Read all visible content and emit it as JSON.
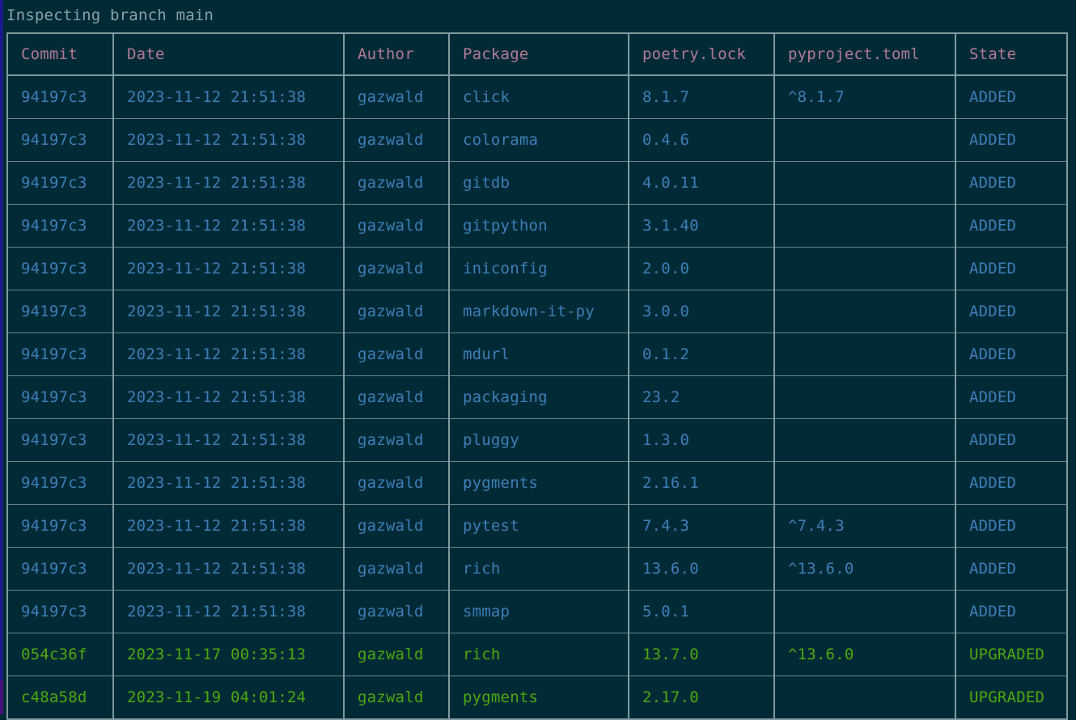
{
  "terminal": {
    "status_line": "Inspecting branch main",
    "colors": {
      "background": "#002b36",
      "border": "#7d9aa0",
      "status_text": "#8aa1a8",
      "header_text": "#b07a96",
      "added_text": "#3f7cb8",
      "upgraded_text": "#4fa60f",
      "left_stripe": "#1a1a8c"
    }
  },
  "table": {
    "columns": [
      {
        "key": "commit",
        "label": "Commit"
      },
      {
        "key": "date",
        "label": "Date"
      },
      {
        "key": "author",
        "label": "Author"
      },
      {
        "key": "package",
        "label": "Package"
      },
      {
        "key": "lock",
        "label": "poetry.lock"
      },
      {
        "key": "toml",
        "label": "pyproject.toml"
      },
      {
        "key": "state",
        "label": "State"
      }
    ],
    "rows": [
      {
        "commit": "94197c3",
        "date": "2023-11-12 21:51:38",
        "author": "gazwald",
        "package": "click",
        "lock": "8.1.7",
        "toml": "^8.1.7",
        "state": "ADDED"
      },
      {
        "commit": "94197c3",
        "date": "2023-11-12 21:51:38",
        "author": "gazwald",
        "package": "colorama",
        "lock": "0.4.6",
        "toml": "",
        "state": "ADDED"
      },
      {
        "commit": "94197c3",
        "date": "2023-11-12 21:51:38",
        "author": "gazwald",
        "package": "gitdb",
        "lock": "4.0.11",
        "toml": "",
        "state": "ADDED"
      },
      {
        "commit": "94197c3",
        "date": "2023-11-12 21:51:38",
        "author": "gazwald",
        "package": "gitpython",
        "lock": "3.1.40",
        "toml": "",
        "state": "ADDED"
      },
      {
        "commit": "94197c3",
        "date": "2023-11-12 21:51:38",
        "author": "gazwald",
        "package": "iniconfig",
        "lock": "2.0.0",
        "toml": "",
        "state": "ADDED"
      },
      {
        "commit": "94197c3",
        "date": "2023-11-12 21:51:38",
        "author": "gazwald",
        "package": "markdown-it-py",
        "lock": "3.0.0",
        "toml": "",
        "state": "ADDED"
      },
      {
        "commit": "94197c3",
        "date": "2023-11-12 21:51:38",
        "author": "gazwald",
        "package": "mdurl",
        "lock": "0.1.2",
        "toml": "",
        "state": "ADDED"
      },
      {
        "commit": "94197c3",
        "date": "2023-11-12 21:51:38",
        "author": "gazwald",
        "package": "packaging",
        "lock": "23.2",
        "toml": "",
        "state": "ADDED"
      },
      {
        "commit": "94197c3",
        "date": "2023-11-12 21:51:38",
        "author": "gazwald",
        "package": "pluggy",
        "lock": "1.3.0",
        "toml": "",
        "state": "ADDED"
      },
      {
        "commit": "94197c3",
        "date": "2023-11-12 21:51:38",
        "author": "gazwald",
        "package": "pygments",
        "lock": "2.16.1",
        "toml": "",
        "state": "ADDED"
      },
      {
        "commit": "94197c3",
        "date": "2023-11-12 21:51:38",
        "author": "gazwald",
        "package": "pytest",
        "lock": "7.4.3",
        "toml": "^7.4.3",
        "state": "ADDED"
      },
      {
        "commit": "94197c3",
        "date": "2023-11-12 21:51:38",
        "author": "gazwald",
        "package": "rich",
        "lock": "13.6.0",
        "toml": "^13.6.0",
        "state": "ADDED"
      },
      {
        "commit": "94197c3",
        "date": "2023-11-12 21:51:38",
        "author": "gazwald",
        "package": "smmap",
        "lock": "5.0.1",
        "toml": "",
        "state": "ADDED"
      },
      {
        "commit": "054c36f",
        "date": "2023-11-17 00:35:13",
        "author": "gazwald",
        "package": "rich",
        "lock": "13.7.0",
        "toml": "^13.6.0",
        "state": "UPGRADED"
      },
      {
        "commit": "c48a58d",
        "date": "2023-11-19 04:01:24",
        "author": "gazwald",
        "package": "pygments",
        "lock": "2.17.0",
        "toml": "",
        "state": "UPGRADED"
      }
    ]
  }
}
